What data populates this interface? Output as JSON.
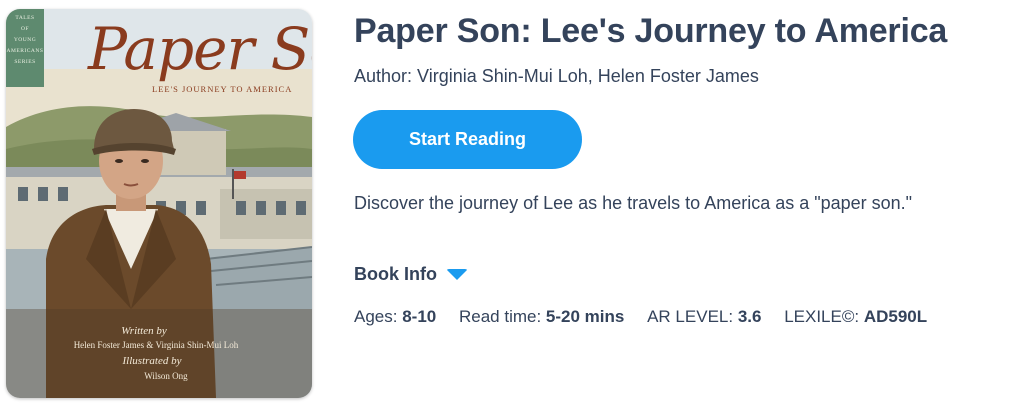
{
  "book": {
    "title": "Paper Son: Lee's Journey to America",
    "author": "Author: Virginia Shin-Mui Loh, Helen Foster James",
    "description": "Discover the journey of Lee as he travels to America as a \"paper son.\""
  },
  "cover": {
    "series": [
      "TALES",
      "OF",
      "YOUNG",
      "AMERICANS",
      "SERIES"
    ],
    "title": "Paper Son",
    "subtitle": "LEE'S JOURNEY TO AMERICA",
    "written_by": "Written by",
    "authors": "Helen Foster James & Virginia Shin-Mui Loh",
    "illustrated_by": "Illustrated by",
    "illustrator": "Wilson Ong"
  },
  "actions": {
    "start_reading": "Start Reading",
    "book_info": "Book Info"
  },
  "meta": {
    "ages_label": "Ages:",
    "ages_value": "8-10",
    "read_time_label": "Read time:",
    "read_time_value": "5-20 mins",
    "ar_label": "AR LEVEL:",
    "ar_value": "3.6",
    "lexile_label": "LEXILE©:",
    "lexile_value": "AD590L"
  },
  "colors": {
    "accent": "#1a9bef",
    "text": "#34435b"
  },
  "icons": {
    "book_info_toggle": "chevron-down-icon"
  }
}
